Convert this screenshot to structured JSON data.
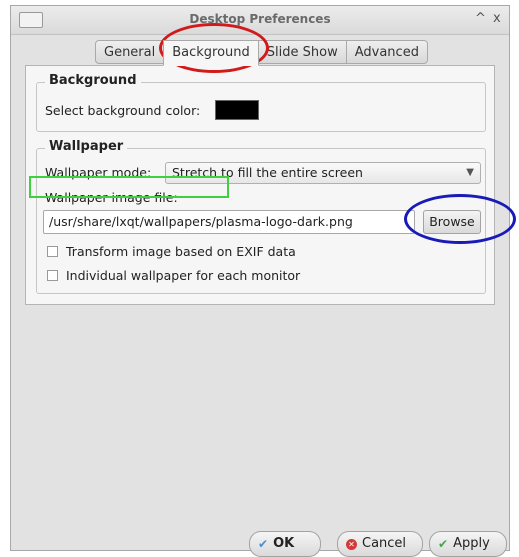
{
  "window": {
    "title": "Desktop Preferences",
    "collapse_glyph": "^",
    "close_glyph": "x"
  },
  "tabs": [
    {
      "label": "General"
    },
    {
      "label": "Background"
    },
    {
      "label": "Slide Show"
    },
    {
      "label": "Advanced"
    }
  ],
  "background_group": {
    "title": "Background",
    "color_label": "Select background color:",
    "color_value": "#000000"
  },
  "wallpaper_group": {
    "title": "Wallpaper",
    "mode_label": "Wallpaper mode:",
    "mode_value": "Stretch to fill the entire screen",
    "file_label": "Wallpaper image file:",
    "file_value": "/usr/share/lxqt/wallpapers/plasma-logo-dark.png",
    "browse_label": "Browse",
    "exif_label": "Transform image based on EXIF data",
    "per_monitor_label": "Individual wallpaper for each monitor"
  },
  "buttons": {
    "ok": "OK",
    "cancel": "Cancel",
    "apply": "Apply"
  },
  "annotation_colors": {
    "red": "#d11a1a",
    "green": "#3fcf3f",
    "blue": "#1a1ab8"
  }
}
